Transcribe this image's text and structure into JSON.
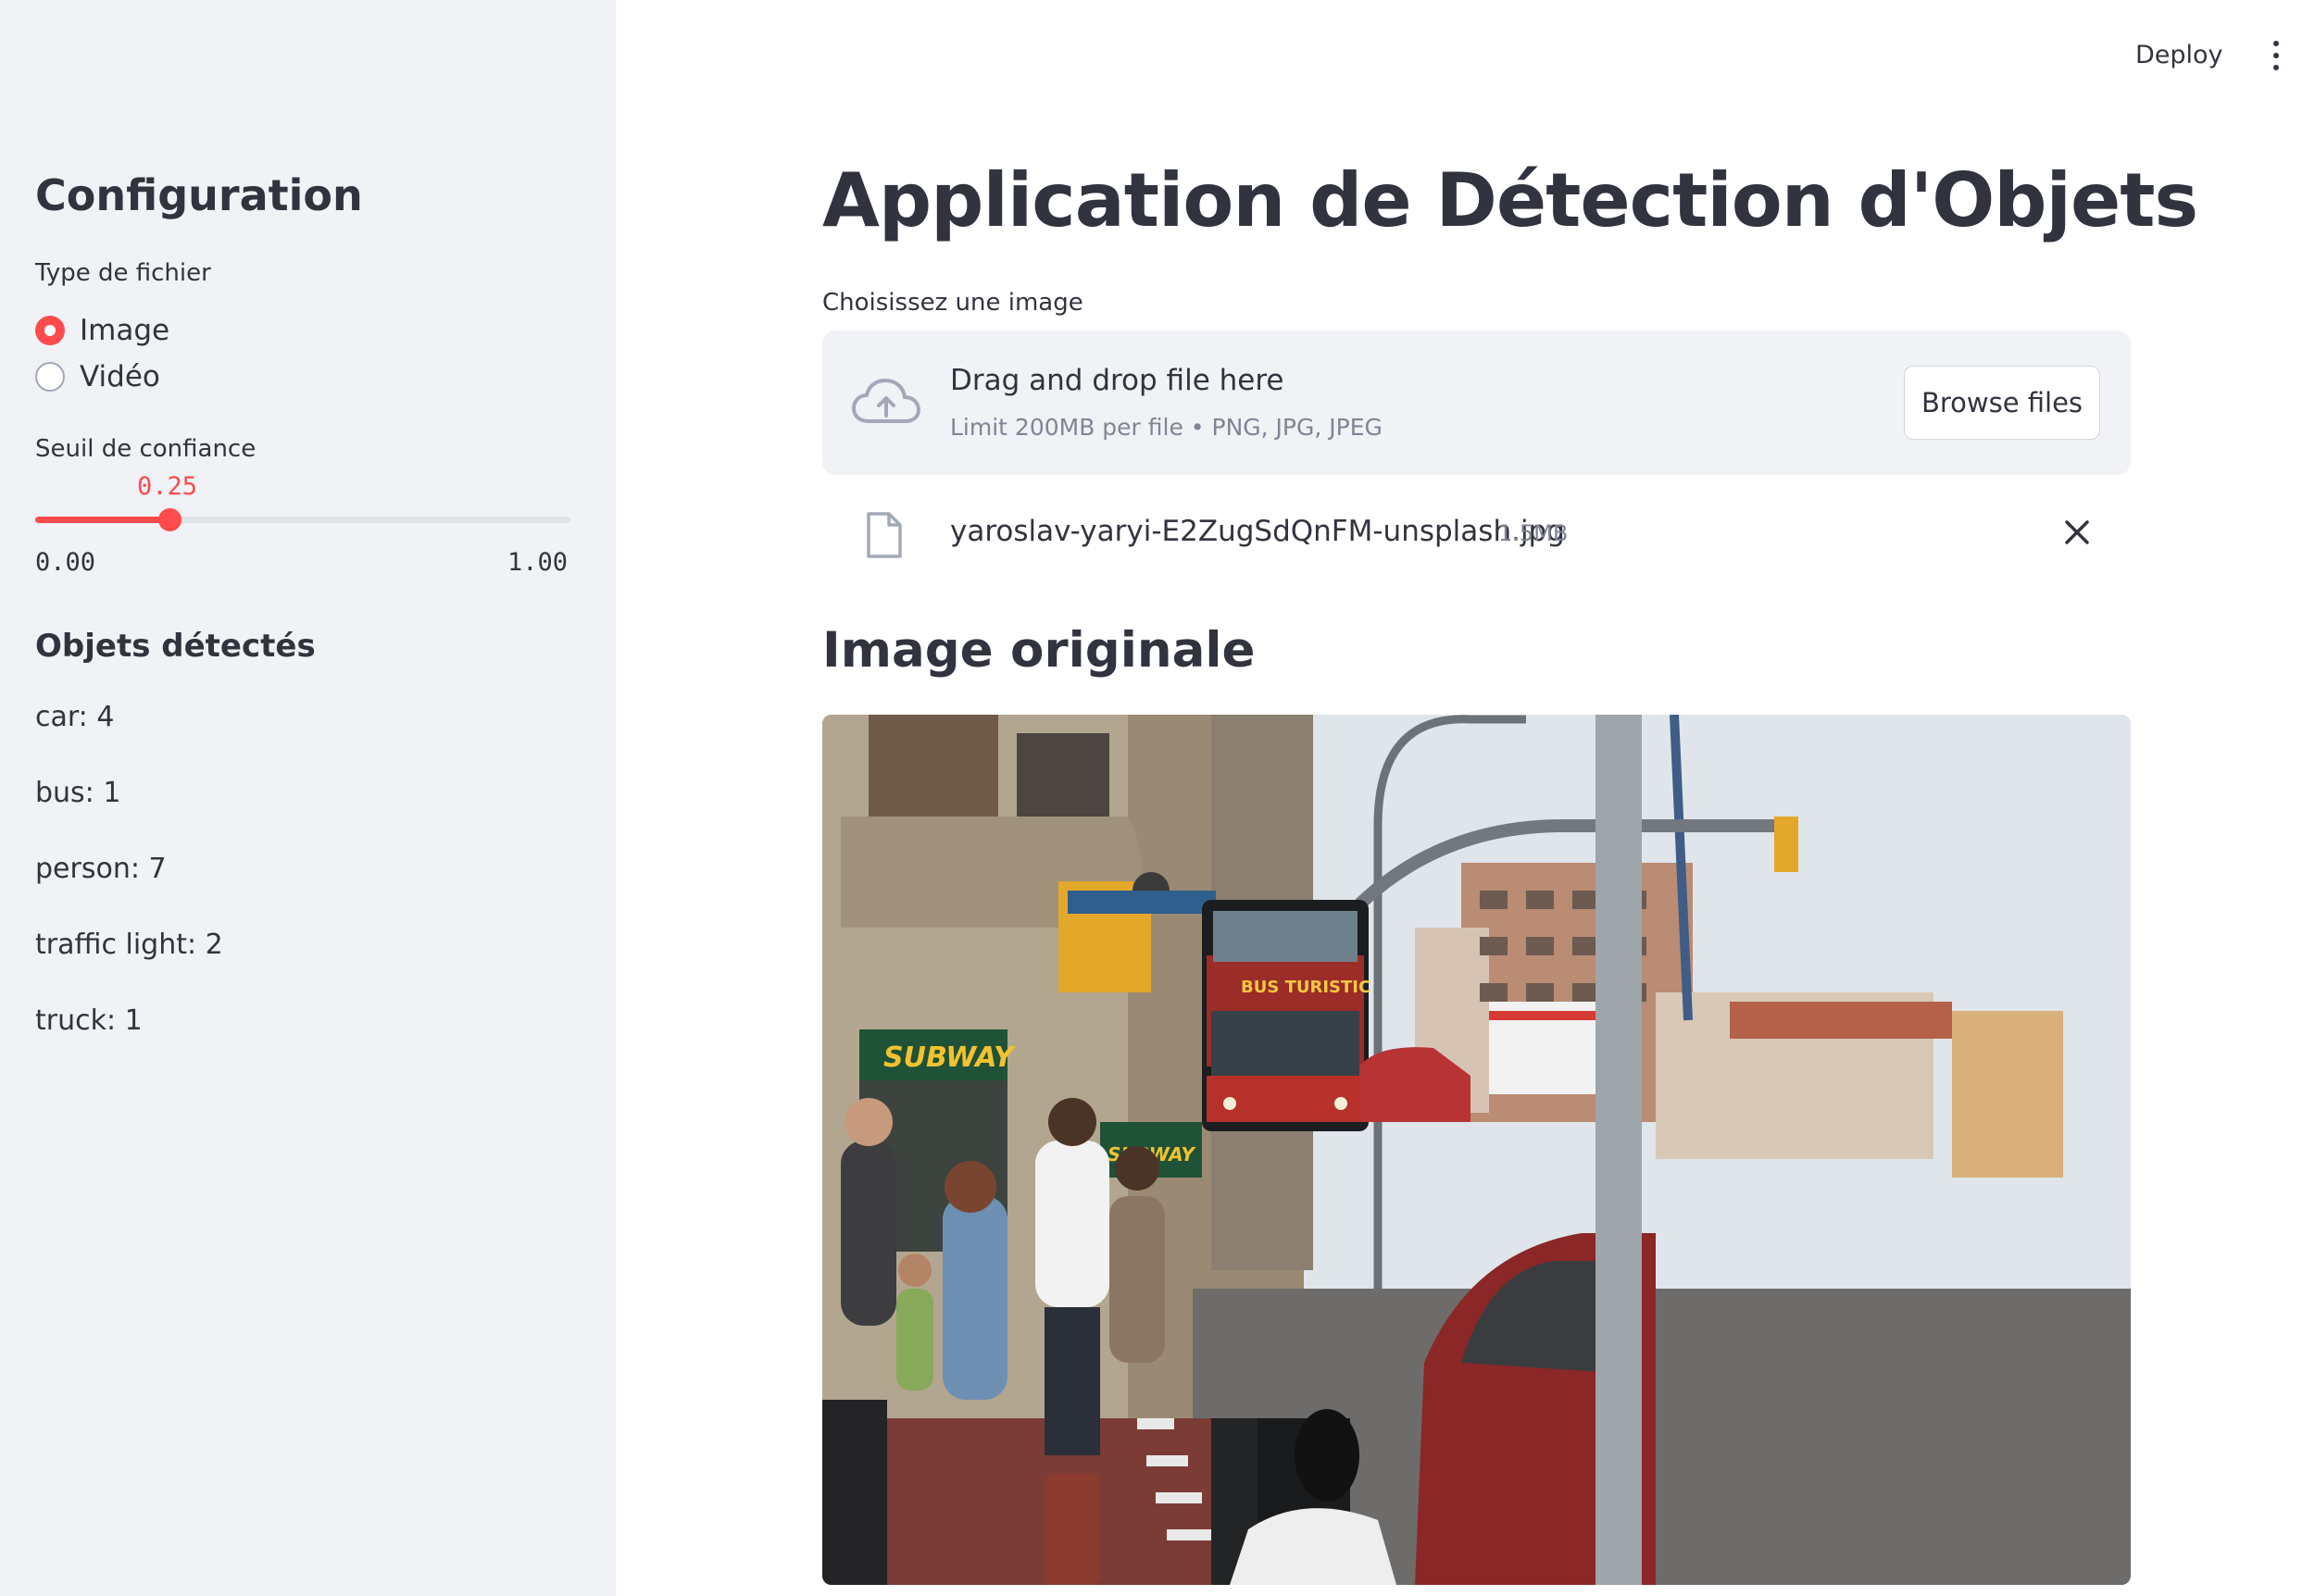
{
  "header": {
    "deploy_label": "Deploy",
    "menu_icon": "vertical-dots-icon"
  },
  "sidebar": {
    "title": "Configuration",
    "file_type": {
      "label": "Type de fichier",
      "options": [
        "Image",
        "Vidéo"
      ],
      "selected": "Image"
    },
    "confidence": {
      "label": "Seuil de confiance",
      "value_display": "0.25",
      "value": 0.25,
      "min_display": "0.00",
      "max_display": "1.00"
    },
    "detected": {
      "title": "Objets détectés",
      "items": [
        "car: 4",
        "bus: 1",
        "person: 7",
        "traffic light: 2",
        "truck: 1"
      ]
    }
  },
  "main": {
    "title": "Application de Détection d'Objets",
    "uploader": {
      "label": "Choisissez une image",
      "drop_text": "Drag and drop file here",
      "limit_text": "Limit 200MB per file • PNG, JPG, JPEG",
      "browse_label": "Browse files"
    },
    "uploaded_file": {
      "name": "yaroslav-yaryi-E2ZugSdQnFM-unsplash.jpg",
      "size": "1.5MB"
    },
    "original_image": {
      "title": "Image originale",
      "signs": {
        "shop1": "SUBWAY",
        "shop2": "SUBWAY",
        "bus_sign": "BUS TURISTIC"
      }
    }
  },
  "colors": {
    "accent": "#ff4b4b",
    "sidebar_bg": "#f0f2f6",
    "text": "#31333f",
    "muted": "#808495"
  }
}
